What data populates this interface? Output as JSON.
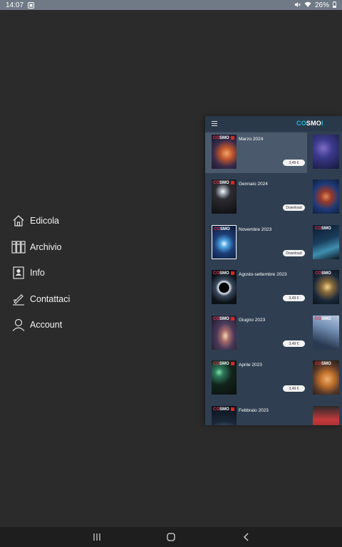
{
  "status_bar": {
    "time": "14:07",
    "notification_icon": "image-notification-icon",
    "battery": "26%",
    "icons": [
      "mute-icon",
      "wifi-icon",
      "battery-icon"
    ]
  },
  "menu": {
    "items": [
      {
        "label": "Edicola",
        "icon": "home-icon"
      },
      {
        "label": "Archivio",
        "icon": "archive-icon"
      },
      {
        "label": "Info",
        "icon": "info-icon"
      },
      {
        "label": "Contattaci",
        "icon": "signature-icon"
      },
      {
        "label": "Account",
        "icon": "user-icon"
      }
    ]
  },
  "app_panel": {
    "logo_part1": "CO",
    "logo_part2": "SMO",
    "logo_part3": "I",
    "issues": [
      {
        "title": "Marzo 2024",
        "action": "3,49 €",
        "selected": true
      },
      {
        "title": "Gennaio 2024",
        "action": "Download",
        "selected": false
      },
      {
        "title": "Novembre 2023",
        "action": "Download",
        "selected": false
      },
      {
        "title": "Agosto-settembre 2023",
        "action": "3,49 €",
        "selected": false
      },
      {
        "title": "Giugno 2023",
        "action": "3,49 €",
        "selected": false
      },
      {
        "title": "Aprile 2023",
        "action": "3,49 €",
        "selected": false
      },
      {
        "title": "Febbraio 2023",
        "action": "",
        "selected": false
      }
    ],
    "cover_masthead": "SMO"
  },
  "nav_bar": {
    "buttons": [
      "recents-icon",
      "home-icon",
      "back-icon"
    ]
  },
  "colors": {
    "background": "#2b2b2b",
    "panel": "#2f3f51",
    "panel_selected": "#4a5a6c",
    "accent": "#1fb7d6"
  }
}
